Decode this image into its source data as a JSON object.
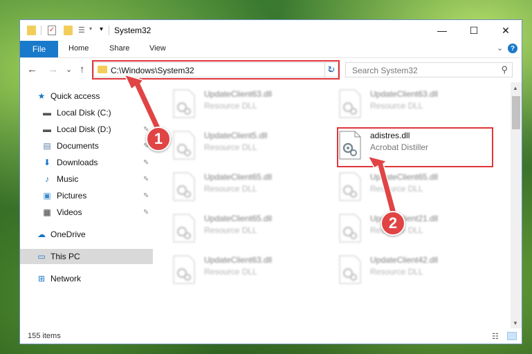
{
  "window": {
    "title": "System32",
    "controls": {
      "minimize": "—",
      "maximize": "☐",
      "close": "✕"
    }
  },
  "ribbon": {
    "file": "File",
    "tabs": [
      "Home",
      "Share",
      "View"
    ],
    "expand": "⌄",
    "help": "?"
  },
  "nav": {
    "back": "←",
    "forward": "→",
    "recent": "⌄",
    "up": "↑",
    "address": "C:\\Windows\\System32",
    "address_dropdown": "⌄",
    "refresh": "↻",
    "search_placeholder": "Search System32",
    "search_icon": "⚲"
  },
  "sidebar": {
    "items": [
      {
        "label": "Quick access",
        "icon": "star-icon",
        "glyph": "★",
        "color": "#1a74c7",
        "pinned": false
      },
      {
        "label": "Local Disk (C:)",
        "icon": "drive-icon",
        "glyph": "▬",
        "color": "#555555",
        "pinned": false
      },
      {
        "label": "Local Disk (D:)",
        "icon": "drive-icon",
        "glyph": "▬",
        "color": "#555555",
        "pinned": true
      },
      {
        "label": "Documents",
        "icon": "documents-icon",
        "glyph": "▤",
        "color": "#5a7fa8",
        "pinned": true
      },
      {
        "label": "Downloads",
        "icon": "downloads-icon",
        "glyph": "⬇",
        "color": "#1a74c7",
        "pinned": true
      },
      {
        "label": "Music",
        "icon": "music-icon",
        "glyph": "♪",
        "color": "#1a74c7",
        "pinned": true
      },
      {
        "label": "Pictures",
        "icon": "pictures-icon",
        "glyph": "▣",
        "color": "#3a8bd0",
        "pinned": true
      },
      {
        "label": "Videos",
        "icon": "videos-icon",
        "glyph": "▦",
        "color": "#333333",
        "pinned": true
      },
      {
        "label": "OneDrive",
        "icon": "onedrive-icon",
        "glyph": "☁",
        "color": "#1a74c7",
        "pinned": false
      },
      {
        "label": "This PC",
        "icon": "this-pc-icon",
        "glyph": "▭",
        "color": "#1a74c7",
        "pinned": false,
        "selected": true
      },
      {
        "label": "Network",
        "icon": "network-icon",
        "glyph": "⊞",
        "color": "#1a74c7",
        "pinned": false
      }
    ],
    "pin_glyph": "📌"
  },
  "files": [
    {
      "name": "UpdateClient63.dll",
      "type": "Resource DLL",
      "blurred": true
    },
    {
      "name": "UpdateClient63.dll",
      "type": "Resource DLL",
      "blurred": true
    },
    {
      "name": "UpdateClient5.dll",
      "type": "Resource DLL",
      "blurred": true
    },
    {
      "name": "adistres.dll",
      "type": "Acrobat Distiller",
      "blurred": false
    },
    {
      "name": "UpdateClient65.dll",
      "type": "Resource DLL",
      "blurred": true
    },
    {
      "name": "UpdateClient65.dll",
      "type": "Resource DLL",
      "blurred": true
    },
    {
      "name": "UpdateClient65.dll",
      "type": "Resource DLL",
      "blurred": true
    },
    {
      "name": "UpdateClient21.dll",
      "type": "Resource DLL",
      "blurred": true
    },
    {
      "name": "UpdateClient63.dll",
      "type": "Resource DLL",
      "blurred": true
    },
    {
      "name": "UpdateClient42.dll",
      "type": "Resource DLL",
      "blurred": true
    }
  ],
  "status": {
    "items": "155 items"
  },
  "callouts": [
    "1",
    "2"
  ],
  "colors": {
    "accent": "#1979ca",
    "highlight": "#e0353a",
    "callout": "#e04444"
  }
}
